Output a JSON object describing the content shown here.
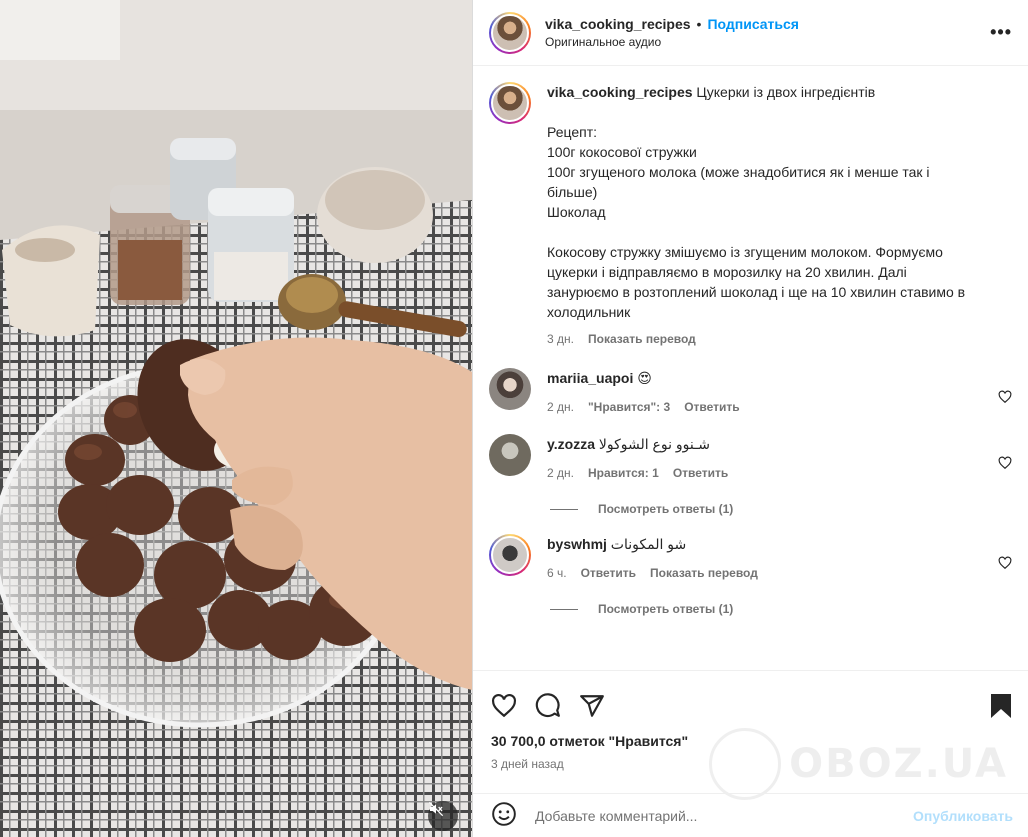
{
  "post": {
    "username": "vika_cooking_recipes",
    "separator": "•",
    "follow_label": "Подписаться",
    "audio": "Оригинальное аудио",
    "more": "•••"
  },
  "caption": {
    "username": "vika_cooking_recipes",
    "title": "Цукерки із двох інгредієнтів",
    "body": "\nРецепт:\n100г кокосової стружки\n100г згущеного молока (може знадобитися як і менше так і більше)\nШоколад\n\nКокосову стружку змішуємо із згущеним молоком. Формуємо цукерки і відправляємо в морозилку на 20 хвилин. Далі занурюємо в розтоплений шоколад і ще на 10 хвилин ставимо в холодильник",
    "time": "3 дн.",
    "translate": "Показать перевод"
  },
  "comments": [
    {
      "username": "mariia_uapoi",
      "text": "😍",
      "time": "2 дн.",
      "likes": "\"Нравится\": 3",
      "reply": "Ответить"
    },
    {
      "username": "y.zozza",
      "text": "شـنوو نوع الشوكولا",
      "time": "2 дн.",
      "likes": "Нравится: 1",
      "reply": "Ответить",
      "view_replies": "Посмотреть ответы (1)"
    },
    {
      "username": "byswhmj",
      "text": "شو المكونات",
      "time": "6 ч.",
      "reply": "Ответить",
      "translate": "Показать перевод",
      "view_replies": "Посмотреть ответы (1)"
    }
  ],
  "footer": {
    "likes": "30 700,0 отметок \"Нравится\"",
    "time": "3 дней назад",
    "add_comment_placeholder": "Добавьте комментарий...",
    "publish": "Опубликовать"
  },
  "watermark": "OBOZ.UA",
  "icons": {
    "like": "heart-icon",
    "comment": "comment-icon",
    "share": "share-icon",
    "save": "bookmark-icon",
    "emoji": "emoji-icon",
    "mute": "muted-speaker-icon"
  },
  "colors": {
    "accent": "#0095f6",
    "publish_disabled": "#b2dffc",
    "muted_text": "#737373"
  }
}
